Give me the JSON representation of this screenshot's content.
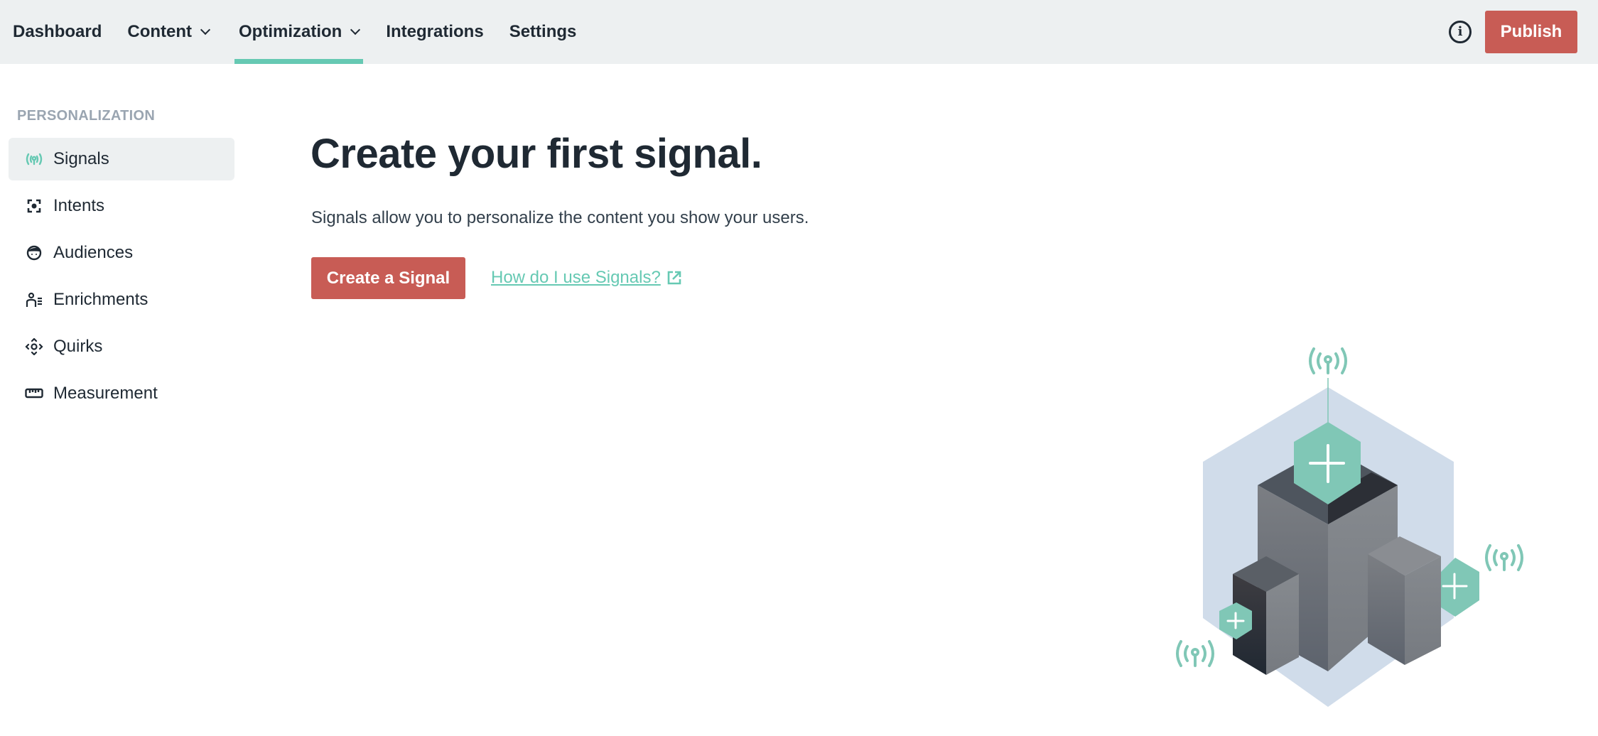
{
  "topbar": {
    "nav": [
      {
        "label": "Dashboard",
        "has_dropdown": false,
        "active": false
      },
      {
        "label": "Content",
        "has_dropdown": true,
        "active": false
      },
      {
        "label": "Optimization",
        "has_dropdown": true,
        "active": true
      },
      {
        "label": "Integrations",
        "has_dropdown": false,
        "active": false
      },
      {
        "label": "Settings",
        "has_dropdown": false,
        "active": false
      }
    ],
    "info_icon": "info-icon",
    "publish_label": "Publish"
  },
  "sidebar": {
    "heading": "PERSONALIZATION",
    "items": [
      {
        "label": "Signals",
        "icon": "signal-icon",
        "active": true
      },
      {
        "label": "Intents",
        "icon": "intent-icon",
        "active": false
      },
      {
        "label": "Audiences",
        "icon": "audience-icon",
        "active": false
      },
      {
        "label": "Enrichments",
        "icon": "enrichment-icon",
        "active": false
      },
      {
        "label": "Quirks",
        "icon": "quirk-icon",
        "active": false
      },
      {
        "label": "Measurement",
        "icon": "ruler-icon",
        "active": false
      }
    ]
  },
  "main": {
    "title": "Create your first signal.",
    "description": "Signals allow you to personalize the content you show your users.",
    "cta_label": "Create a Signal",
    "help_link_label": "How do I use Signals?"
  },
  "colors": {
    "accent": "#66c9b3",
    "primary_button": "#c85c55",
    "topbar_bg": "#edf0f1",
    "text": "#1f2933",
    "muted": "#9aa5b1"
  }
}
